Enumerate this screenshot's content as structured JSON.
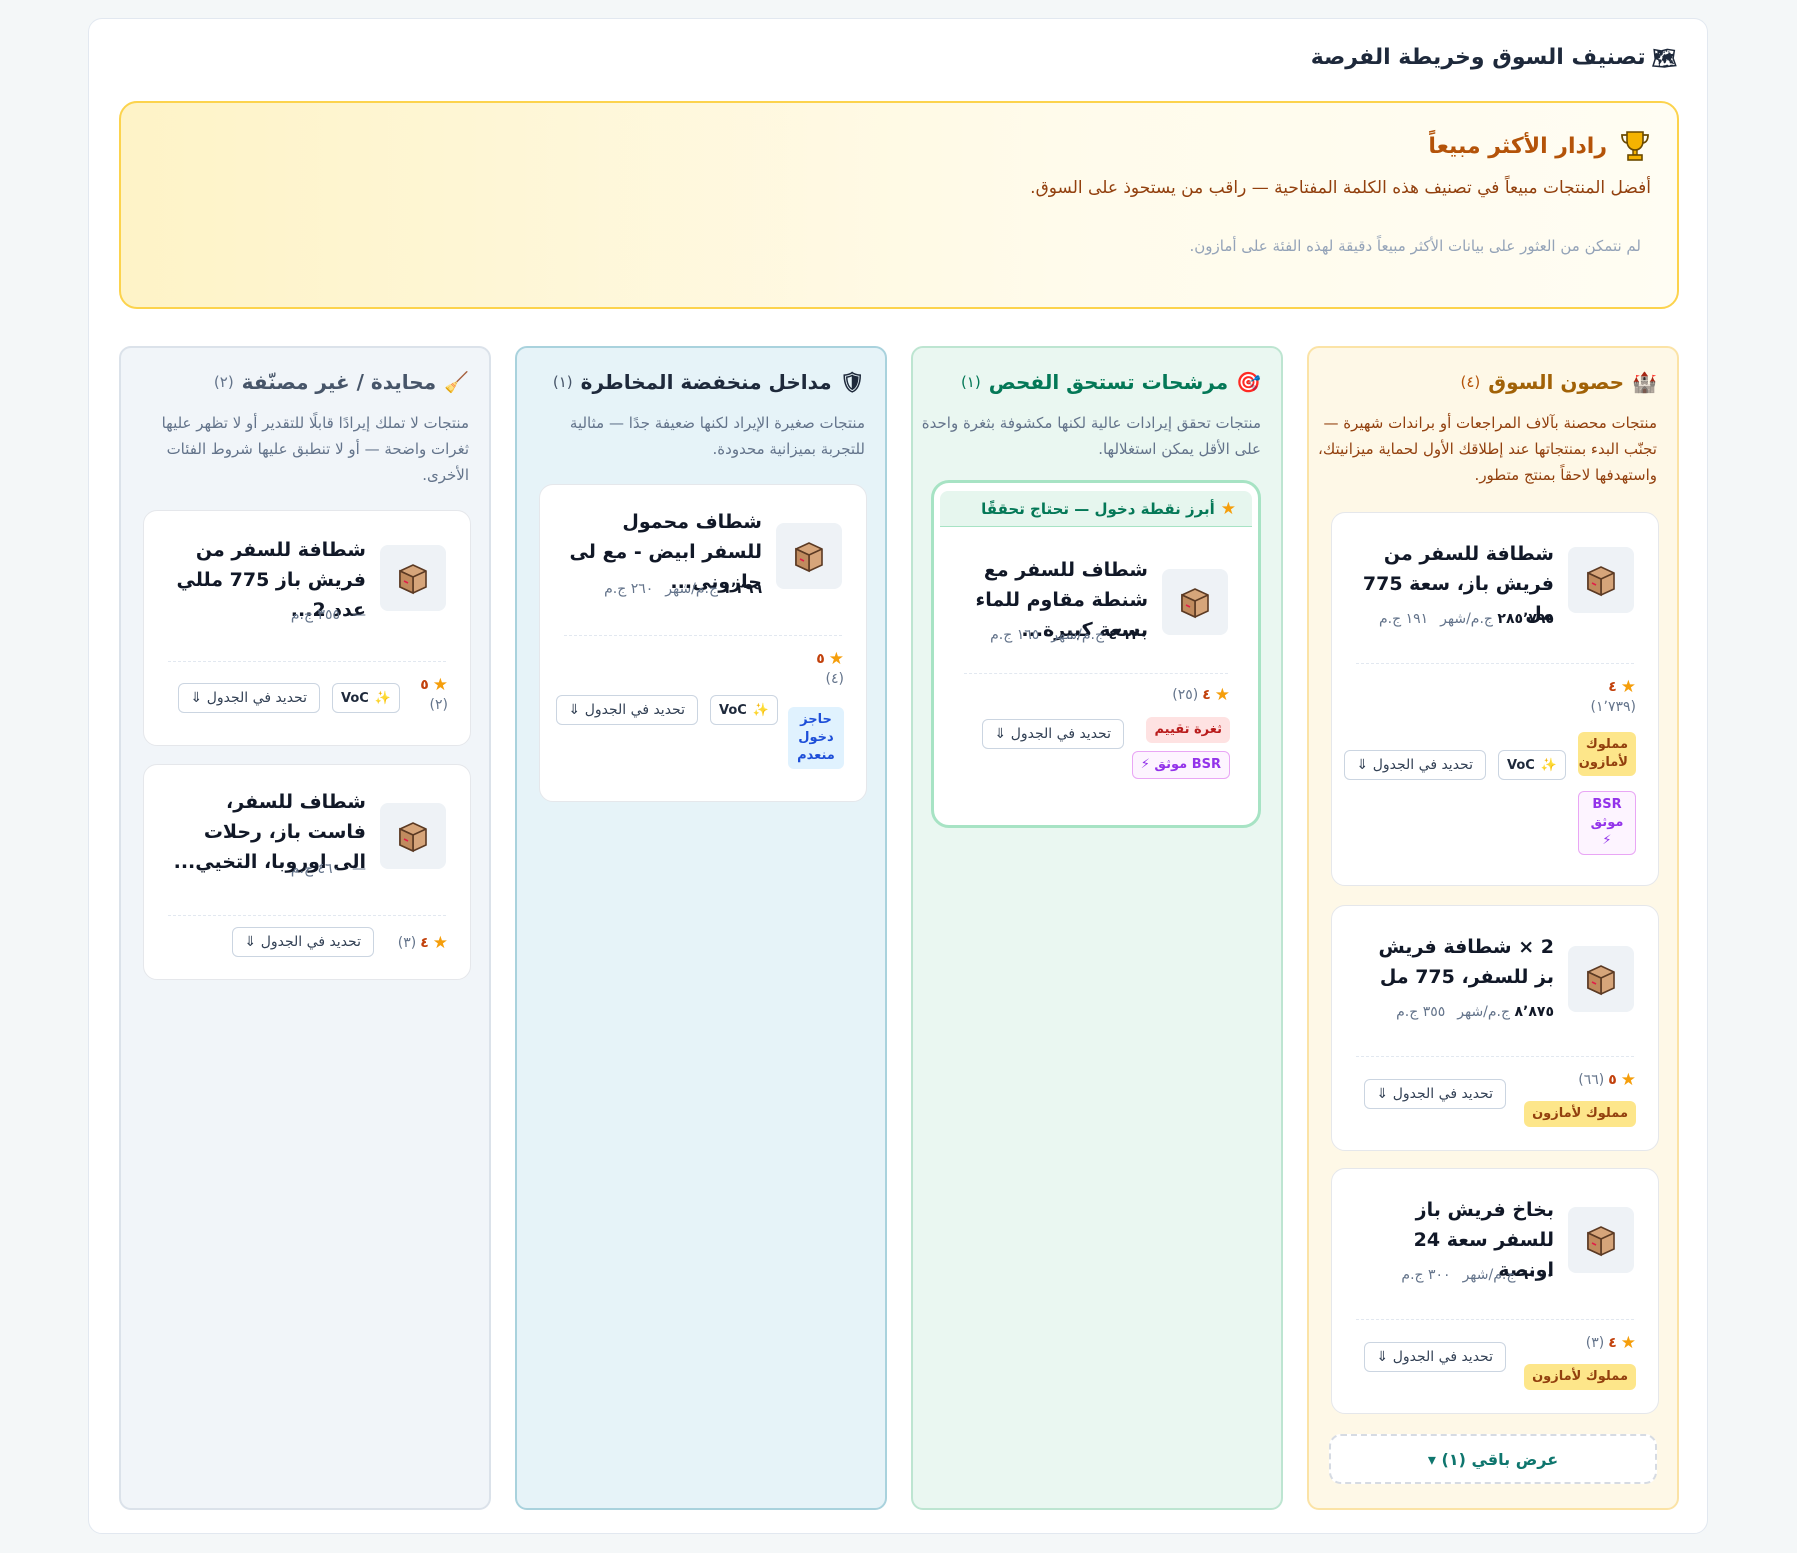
{
  "panel": {
    "title": "تصنيف السوق وخريطة الفرصة",
    "title_icon": "🗺"
  },
  "radar": {
    "title": "رادار الأكثر مبيعاً",
    "subtitle": "أفضل المنتجات مبيعاً في تصنيف هذه الكلمة المفتاحية — راقب من يستحوذ على السوق.",
    "empty": "لم نتمكن من العثور على بيانات الأكثر مبيعاً دقيقة لهذه الفئة على أمازون."
  },
  "common": {
    "locate_btn": "تحديد في الجدول ⇓",
    "voc_btn": "VoC",
    "amazon_badge": "مملوك لأمازون",
    "amazon_badge_stacked": "مملوك لأمازون",
    "bsr_badge": "BSR موثق ⚡",
    "bsr_badge_stacked": "BSR موثق ⚡"
  },
  "columns": {
    "fortresses": {
      "icon": "🏰",
      "title": "حصون السوق",
      "count": "(٤)",
      "desc": "منتجات محصنة بآلاف المراجعات أو براندات شهيرة — تجنّب البدء بمنتجاتها عند إطلاقك الأول لحماية ميزانيتك، واستهدفها لاحقاً بمنتج متطور.",
      "show_more": "عرض باقي (١) ▾",
      "cards": [
        {
          "title": "شطافة للسفر من فريش باز، سعة 775 مل",
          "revenue": "٢٨٥٬٧٩٥",
          "revenue_unit": "ج.م/شهر",
          "price": "١٩١ ج.م",
          "score": "٤",
          "reviews": "(١٬٧٣٩)"
        },
        {
          "title": "2 × شطافة فريش بز للسفر، 775 مل",
          "revenue": "٨٬٨٧٥",
          "revenue_unit": "ج.م/شهر",
          "price": "٣٥٥ ج.م",
          "score": "٥",
          "reviews": "(٦٦)"
        },
        {
          "title": "بخاخ فريش باز للسفر سعة 24 اونصة",
          "revenue": "٦٠٠٠",
          "revenue_unit": "ج.م/شهر",
          "price": "٣٠٠ ج.م",
          "score": "٤",
          "reviews": "(٣)"
        }
      ]
    },
    "candidates": {
      "icon": "🎯",
      "title": "مرشحات تستحق الفحص",
      "count": "(١)",
      "desc": "منتجات تحقق إيرادات عالية لكنها مكشوفة بثغرة واحدة على الأقل يمكن استغلالها.",
      "featured_banner": "أبرز نقطة دخول — تحتاج تحققًا",
      "cards": [
        {
          "title": "شطاف للسفر مع شنطة مقاوم للماء بسعة كبيرة...",
          "revenue": "٤٬١٢٠",
          "revenue_unit": "ج.م/شهر",
          "price": "١٦٥ ج.م",
          "score": "٤",
          "reviews": "(٢٥)",
          "gap_badge": "ثغرة تقييم"
        }
      ]
    },
    "low_risk": {
      "icon": "🛡",
      "title": "مداخل منخفضة المخاطرة",
      "count": "(١)",
      "desc": "منتجات صغيرة الإيراد لكنها ضعيفة جدًا — مثالية للتجربة بميزانية محدودة.",
      "cards": [
        {
          "title": "شطاف محمول للسفر ابيض - مع لى حازونى...",
          "revenue": "١٬٢٩٩",
          "revenue_unit": "ج.م/شهر",
          "price": "٢٦٠ ج.م",
          "score": "٥",
          "reviews": "(٤)",
          "barrier_badge": "حاجز دخول منعدم"
        }
      ]
    },
    "neutral": {
      "icon": "🧹",
      "title": "محايدة / غير مصنّفة",
      "count": "(٢)",
      "desc": "منتجات لا تملك إيرادًا قابلًا للتقدير أو لا تظهر عليها ثغرات واضحة — أو لا تنطبق عليها شروط الفئات الأخرى.",
      "cards": [
        {
          "title": "شطافة للسفر من فريش باز 775 مللي عدد 2...",
          "revenue": "—",
          "price": "٣٥٥ ج.م",
          "score": "٥",
          "reviews": "(٢)"
        },
        {
          "title": "شطاف للسفر، فاست باز، رحلات الى اوروبا، التخيي...",
          "revenue": "—",
          "price": "٤٦٠ ج.م",
          "score": "٤",
          "reviews": "(٣)"
        }
      ]
    }
  },
  "icons": {
    "trophy": "trophy-icon",
    "product": "package-icon",
    "star": "star-icon",
    "voc": "magic-wand-icon",
    "locate": "arrow-down-icon"
  },
  "colors": {
    "fortress_bg": "#fef8e7",
    "candidate_bg": "#eaf7f1",
    "low_risk_bg": "#e6f3f8",
    "neutral_bg": "#f1f5f9",
    "radar_border": "#fcd34d"
  }
}
